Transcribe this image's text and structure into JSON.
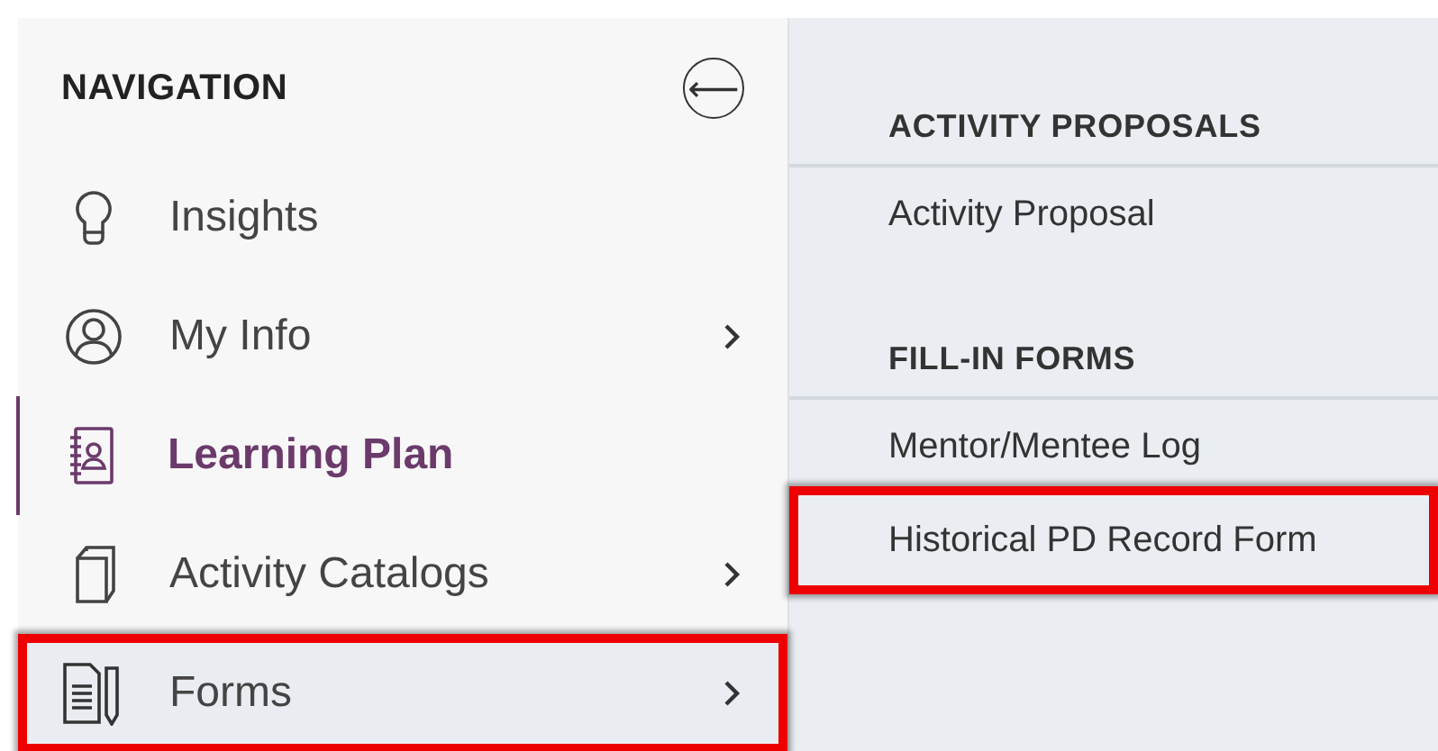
{
  "navigation": {
    "title": "NAVIGATION",
    "collapse_button": "⟵",
    "items": [
      {
        "label": "Insights",
        "selected": false,
        "has_submenu": false,
        "highlighted": false
      },
      {
        "label": "My Info",
        "selected": false,
        "has_submenu": true,
        "highlighted": false
      },
      {
        "label": "Learning Plan",
        "selected": true,
        "has_submenu": false,
        "highlighted": false
      },
      {
        "label": "Activity Catalogs",
        "selected": false,
        "has_submenu": true,
        "highlighted": false
      },
      {
        "label": "Forms",
        "selected": false,
        "has_submenu": true,
        "highlighted": true
      }
    ]
  },
  "submenu": {
    "sections": [
      {
        "title": "ACTIVITY PROPOSALS",
        "items": [
          {
            "label": "Activity Proposal",
            "highlighted": false
          }
        ]
      },
      {
        "title": "FILL-IN FORMS",
        "items": [
          {
            "label": "Mentor/Mentee Log",
            "highlighted": false
          },
          {
            "label": "Historical PD Record Form",
            "highlighted": true
          }
        ]
      }
    ]
  }
}
